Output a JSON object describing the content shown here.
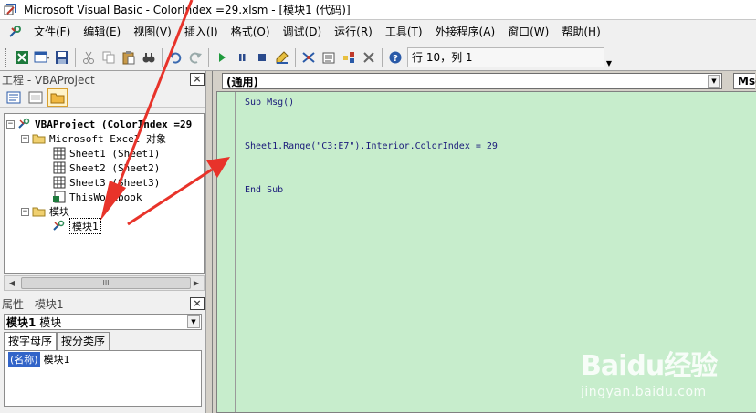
{
  "window": {
    "title": "Microsoft Visual Basic - ColorIndex =29.xlsm - [模块1 (代码)]"
  },
  "menubar": {
    "items": [
      {
        "label": "文件(F)"
      },
      {
        "label": "编辑(E)"
      },
      {
        "label": "视图(V)"
      },
      {
        "label": "插入(I)"
      },
      {
        "label": "格式(O)"
      },
      {
        "label": "调试(D)"
      },
      {
        "label": "运行(R)"
      },
      {
        "label": "工具(T)"
      },
      {
        "label": "外接程序(A)"
      },
      {
        "label": "窗口(W)"
      },
      {
        "label": "帮助(H)"
      }
    ]
  },
  "toolbar": {
    "cursor_position": "行 10，列 1"
  },
  "project_panel": {
    "title": "工程 - VBAProject",
    "close": "×",
    "tree": {
      "root": "VBAProject (ColorIndex =29",
      "excel_objects": "Microsoft Excel 对象",
      "sheets": [
        "Sheet1 (Sheet1)",
        "Sheet2 (Sheet2)",
        "Sheet3 (Sheet3)"
      ],
      "workbook": "ThisWorkbook",
      "modules_folder": "模块",
      "module1": "模块1"
    },
    "scroll_thumb": "III"
  },
  "properties_panel": {
    "title": "属性 - 模块1",
    "close": "×",
    "object_name": "模块1",
    "object_type": "模块",
    "tabs": [
      "按字母序",
      "按分类序"
    ],
    "rows": [
      {
        "key": "(名称)",
        "value": "模块1"
      }
    ]
  },
  "code_window": {
    "object_combo": "(通用)",
    "proc_combo": "Msg",
    "lines": [
      "Sub Msg()",
      "Sheet1.Range(\"C3:E7\").Interior.ColorIndex = 29",
      "End Sub"
    ]
  },
  "watermark": {
    "brand": "Baidu经验",
    "url": "jingyan.baidu.com"
  },
  "colors": {
    "code_bg": "#c7edcc",
    "annotation_arrow": "#e8332a",
    "selection": "#3264c8"
  }
}
